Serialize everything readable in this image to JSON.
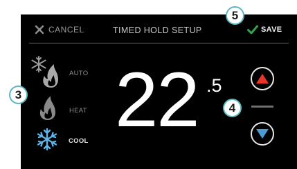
{
  "header": {
    "cancel_label": "CANCEL",
    "title": "TIMED HOLD SETUP",
    "save_label": "SAVE"
  },
  "modes": [
    {
      "label": "AUTO",
      "icon": "snowflake-flame-icon",
      "selected": false
    },
    {
      "label": "HEAT",
      "icon": "flame-icon",
      "selected": false
    },
    {
      "label": "COOL",
      "icon": "snowflake-icon",
      "selected": true
    }
  ],
  "temperature": {
    "whole": "22",
    "decimal": ".5"
  },
  "callouts": [
    "3",
    "4",
    "5"
  ],
  "colors": {
    "background": "#000000",
    "up_arrow": "#e8342a",
    "down_arrow": "#4d9bd4",
    "save_check": "#2fa64b",
    "cool_icon": "#5fb4ea",
    "callout_border": "#59b7c2"
  }
}
